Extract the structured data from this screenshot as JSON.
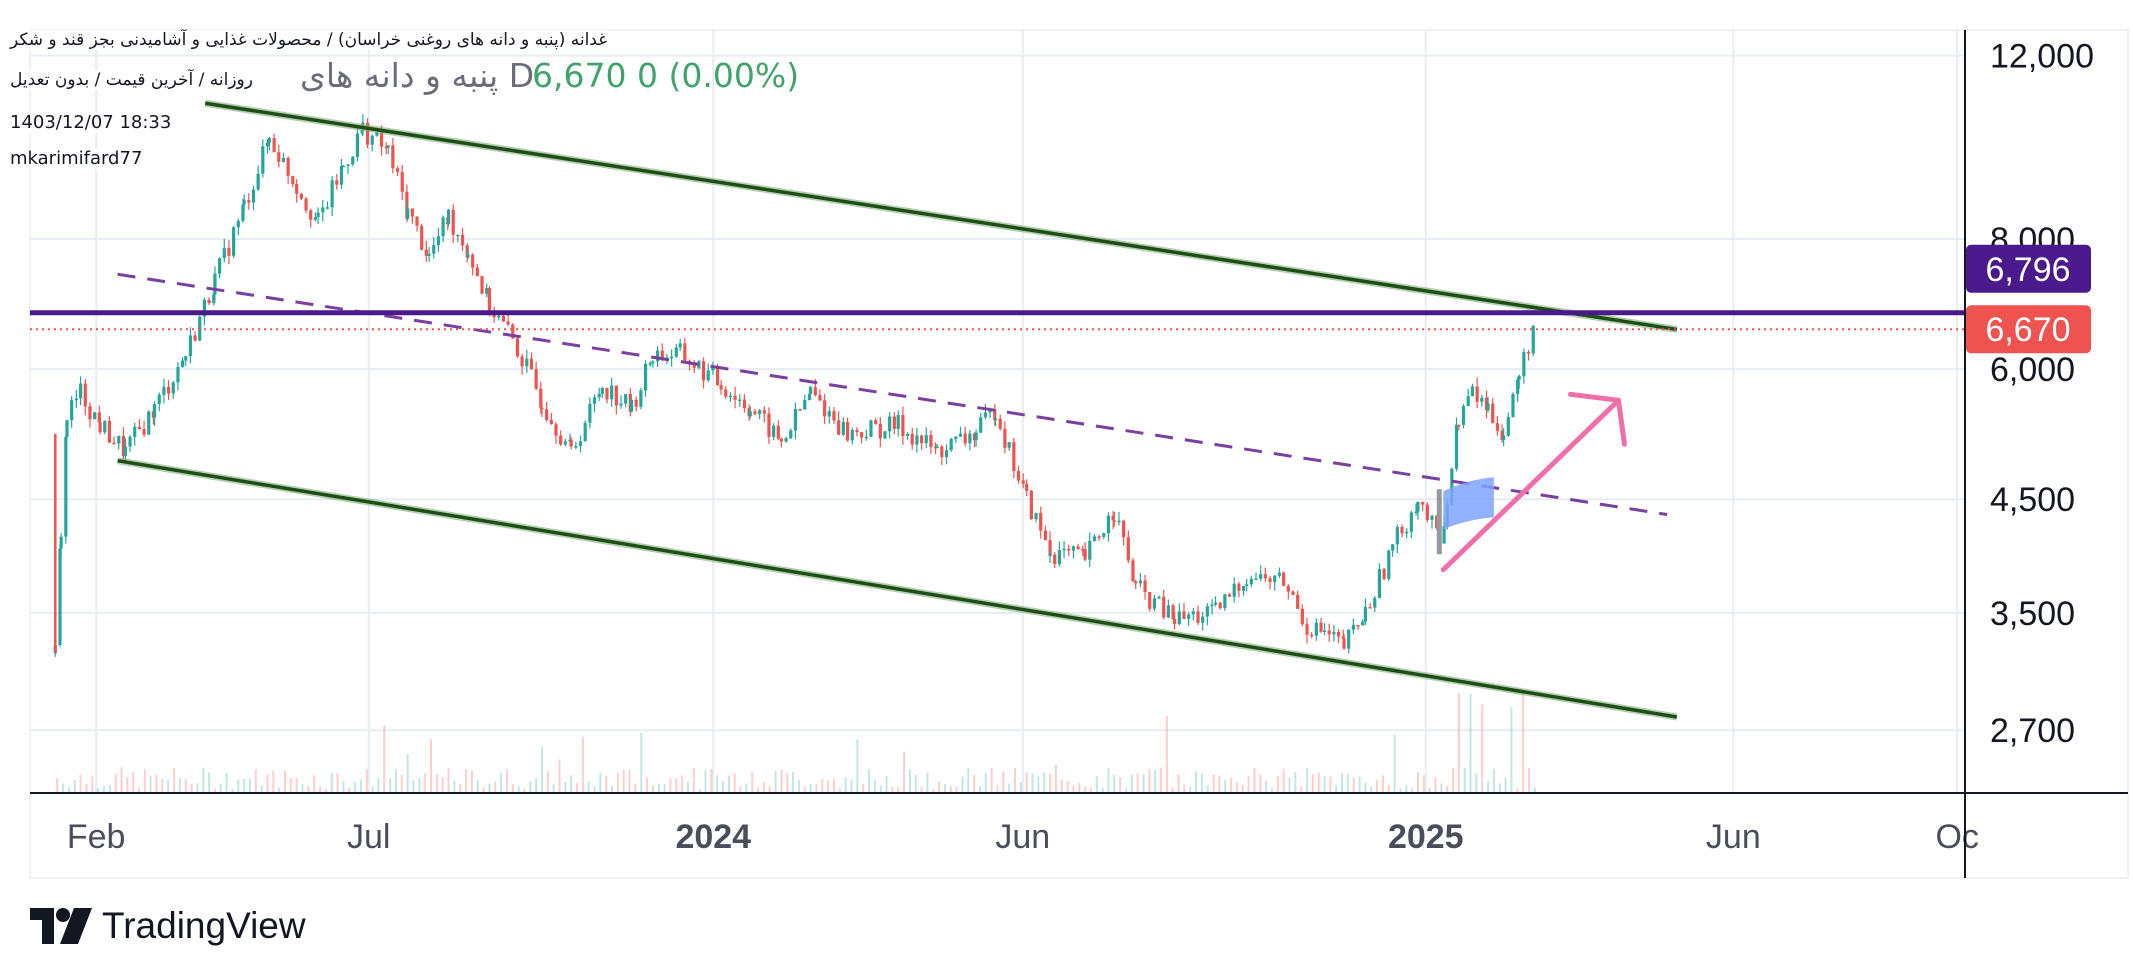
{
  "header": {
    "title": "غدانه (پنبه و دانه های روغنی خراسان) / محصولات غذایی و آشامیدنی بجز قند و شکر",
    "subtitle": "روزانه / آخرین قیمت / بدون تعدیل",
    "datetime": "1403/12/07 18:33",
    "author": "mkarimifard77",
    "symbol_line": "پنبه و دانه های D",
    "last_price": "6,670",
    "change": "0 (0.00%)"
  },
  "branding": {
    "logo_text": "TradingView"
  },
  "colors": {
    "up": "#26a69a",
    "down": "#ef5350",
    "channel": "#1e4d16",
    "midline": "#7b3fa0",
    "resistance": "#4a1a8c",
    "current_price": "#ef5350",
    "arrow": "#f06ea9",
    "flag": "#7fa3ff"
  },
  "chart_data": {
    "type": "candlestick",
    "x_axis_labels": [
      "Feb",
      "Jul",
      "2024",
      "Jun",
      "2025",
      "Jun",
      "Oc"
    ],
    "x_axis_bold": [
      "2024",
      "2025"
    ],
    "y_axis_labels": [
      "12,000",
      "8,000",
      "6,000",
      "4,500",
      "3,500",
      "2,700"
    ],
    "y_scale": "log",
    "y_range": [
      2350,
      12700
    ],
    "price_markers": [
      {
        "label": "6,796",
        "value": 6796,
        "color": "#4a1a8c"
      },
      {
        "label": "6,670",
        "value": 6670,
        "color": "#ef5350"
      }
    ],
    "series_trace": [
      [
        "2023-01-28",
        3200
      ],
      [
        "2023-01-31",
        4200
      ],
      [
        "2023-02-03",
        5400
      ],
      [
        "2023-02-10",
        5700
      ],
      [
        "2023-02-20",
        5300
      ],
      [
        "2023-03-05",
        5000
      ],
      [
        "2023-03-20",
        5500
      ],
      [
        "2023-04-05",
        6200
      ],
      [
        "2023-04-20",
        7300
      ],
      [
        "2023-05-05",
        8600
      ],
      [
        "2023-05-18",
        10000
      ],
      [
        "2023-06-01",
        9000
      ],
      [
        "2023-06-12",
        8300
      ],
      [
        "2023-06-25",
        9400
      ],
      [
        "2023-07-05",
        10200
      ],
      [
        "2023-07-18",
        9700
      ],
      [
        "2023-07-28",
        8500
      ],
      [
        "2023-08-08",
        7700
      ],
      [
        "2023-08-18",
        8400
      ],
      [
        "2023-08-28",
        7800
      ],
      [
        "2023-09-08",
        6900
      ],
      [
        "2023-09-20",
        6400
      ],
      [
        "2023-10-05",
        5600
      ],
      [
        "2023-10-20",
        5000
      ],
      [
        "2023-11-05",
        5800
      ],
      [
        "2023-11-20",
        5500
      ],
      [
        "2023-12-01",
        6200
      ],
      [
        "2023-12-15",
        6200
      ],
      [
        "2024-01-05",
        5800
      ],
      [
        "2024-01-20",
        5500
      ],
      [
        "2024-02-05",
        5100
      ],
      [
        "2024-02-20",
        5700
      ],
      [
        "2024-03-10",
        5200
      ],
      [
        "2024-04-05",
        5300
      ],
      [
        "2024-04-25",
        5000
      ],
      [
        "2024-05-15",
        5200
      ],
      [
        "2024-05-25",
        5500
      ],
      [
        "2024-06-01",
        5000
      ],
      [
        "2024-06-10",
        4500
      ],
      [
        "2024-06-22",
        4000
      ],
      [
        "2024-07-10",
        3950
      ],
      [
        "2024-07-25",
        4400
      ],
      [
        "2024-08-05",
        3700
      ],
      [
        "2024-08-25",
        3450
      ],
      [
        "2024-09-15",
        3500
      ],
      [
        "2024-10-01",
        3800
      ],
      [
        "2024-10-20",
        3750
      ],
      [
        "2024-11-01",
        3400
      ],
      [
        "2024-11-10",
        3350
      ],
      [
        "2024-11-20",
        3250
      ],
      [
        "2024-12-01",
        3500
      ],
      [
        "2024-12-15",
        4050
      ],
      [
        "2024-12-28",
        4500
      ],
      [
        "2025-01-08",
        4100
      ],
      [
        "2025-01-12",
        4500
      ],
      [
        "2025-01-18",
        5400
      ],
      [
        "2025-01-25",
        5700
      ],
      [
        "2025-02-02",
        5500
      ],
      [
        "2025-02-10",
        5200
      ],
      [
        "2025-02-18",
        5900
      ],
      [
        "2025-02-26",
        6670
      ]
    ],
    "drawings": [
      {
        "kind": "channel-upper",
        "from": [
          "2023-04-15",
          10800
        ],
        "to": [
          "2025-05-10",
          6550
        ]
      },
      {
        "kind": "channel-lower",
        "from": [
          "2023-03-01",
          4900
        ],
        "to": [
          "2025-05-10",
          2780
        ]
      },
      {
        "kind": "channel-midline-dashed",
        "from": [
          "2023-03-01",
          7400
        ],
        "to": [
          "2025-05-05",
          4350
        ]
      },
      {
        "kind": "horizontal-resistance",
        "value": 6796
      },
      {
        "kind": "horizontal-dotted-price",
        "value": 6670
      },
      {
        "kind": "arrow-up",
        "from": [
          "2025-01-10",
          3850
        ],
        "to": [
          "2025-04-10",
          5600
        ]
      },
      {
        "kind": "flag",
        "from": [
          "2025-01-10",
          4500
        ],
        "to": [
          "2025-02-05",
          4600
        ]
      }
    ],
    "volume_shown": true,
    "grid": true
  }
}
